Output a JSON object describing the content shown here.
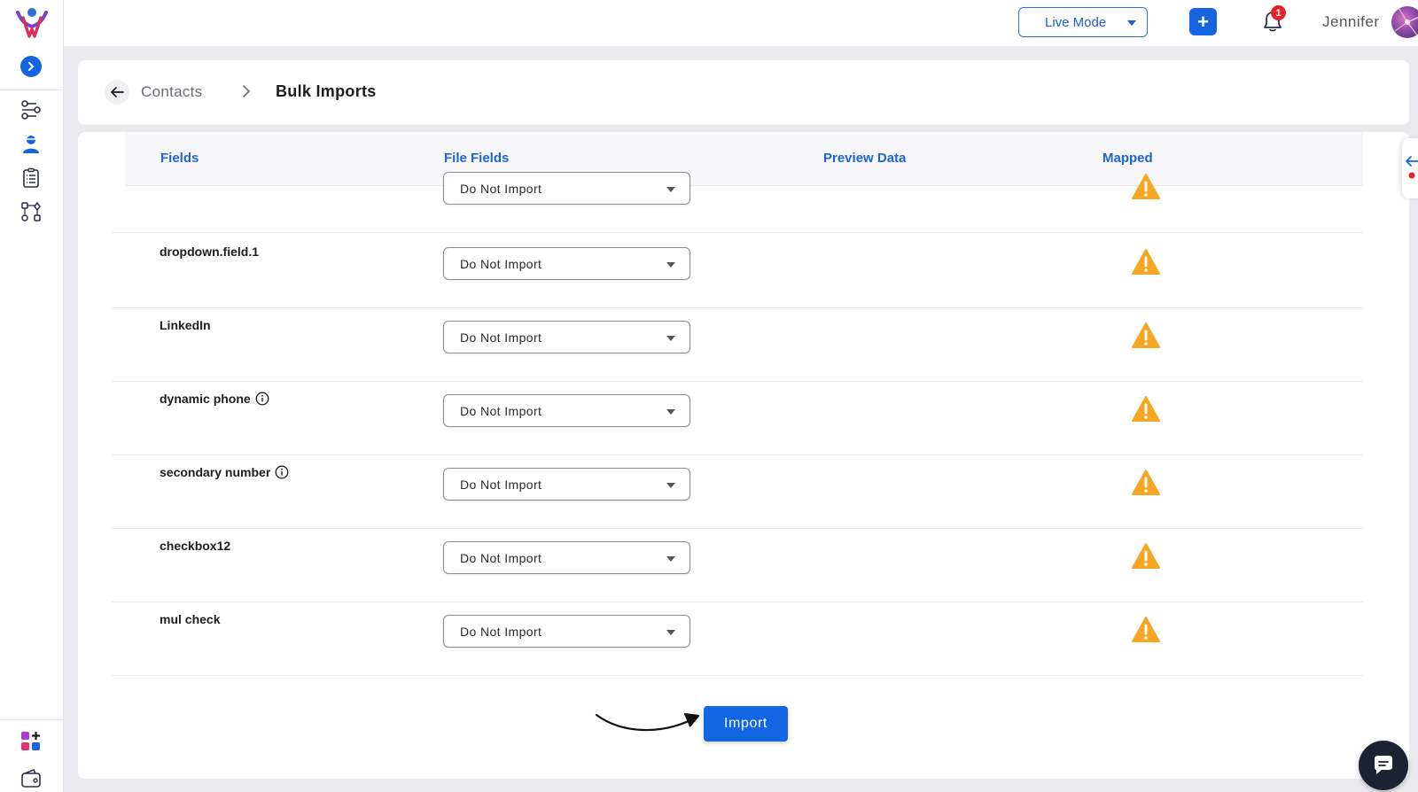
{
  "header": {
    "mode_label": "Live Mode",
    "add_label": "+",
    "notification_count": "1",
    "user_name": "Jennifer"
  },
  "breadcrumb": {
    "parent": "Contacts",
    "current": "Bulk Imports"
  },
  "table": {
    "columns": [
      "Fields",
      "File Fields",
      "Preview Data",
      "Mapped"
    ],
    "rows": [
      {
        "name": "",
        "file_field": "Do Not Import",
        "info": false
      },
      {
        "name": "dropdown.field.1",
        "file_field": "Do Not Import",
        "info": false
      },
      {
        "name": "LinkedIn",
        "file_field": "Do Not Import",
        "info": false
      },
      {
        "name": "dynamic phone",
        "file_field": "Do Not Import",
        "info": true
      },
      {
        "name": "secondary number",
        "file_field": "Do Not Import",
        "info": true
      },
      {
        "name": "checkbox12",
        "file_field": "Do Not Import",
        "info": false
      },
      {
        "name": "mul check",
        "file_field": "Do Not Import",
        "info": false
      }
    ]
  },
  "actions": {
    "import_label": "Import"
  },
  "icons": {
    "sidebar": [
      "workflow-icon",
      "contacts-icon",
      "checklist-icon",
      "automation-icon",
      "apps-icon",
      "wallet-icon"
    ]
  },
  "colors": {
    "primary": "#1565e0",
    "warning": "#f5a623",
    "badge": "#e8202a"
  }
}
